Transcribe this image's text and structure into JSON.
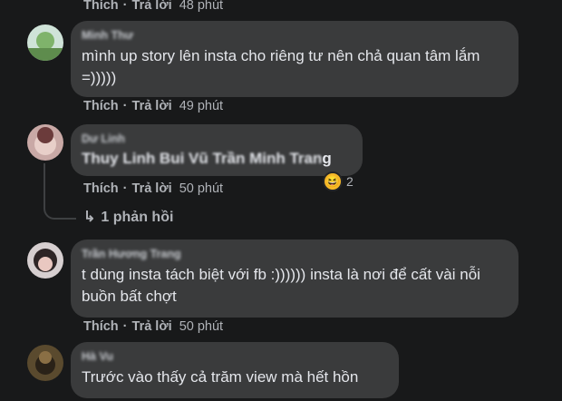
{
  "action_labels": {
    "like": "Thích",
    "reply": "Trả lời",
    "separator": "·"
  },
  "comments": [
    {
      "name": "",
      "text": "",
      "time": "48 phút"
    },
    {
      "name": "Minh Thư",
      "text": "mình up story lên insta cho riêng tư nên chả quan tâm lắm =)))))",
      "time": "49 phút"
    },
    {
      "name": "Dư Linh",
      "text_blurred": "Thuy Linh Bui Vũ Trần Minh Tran",
      "text_tail": "g",
      "time": "50 phút",
      "reaction_count": "2",
      "replies_label": "1 phản hồi"
    },
    {
      "name": "Trần Hương Trang",
      "text": "t dùng insta tách biệt với fb :)))))) insta là nơi để cất vài nỗi buồn bất chợt",
      "time": "50 phút"
    },
    {
      "name": "Hà Vu",
      "text": "Trước vào thấy cả trăm view mà hết hồn"
    }
  ]
}
